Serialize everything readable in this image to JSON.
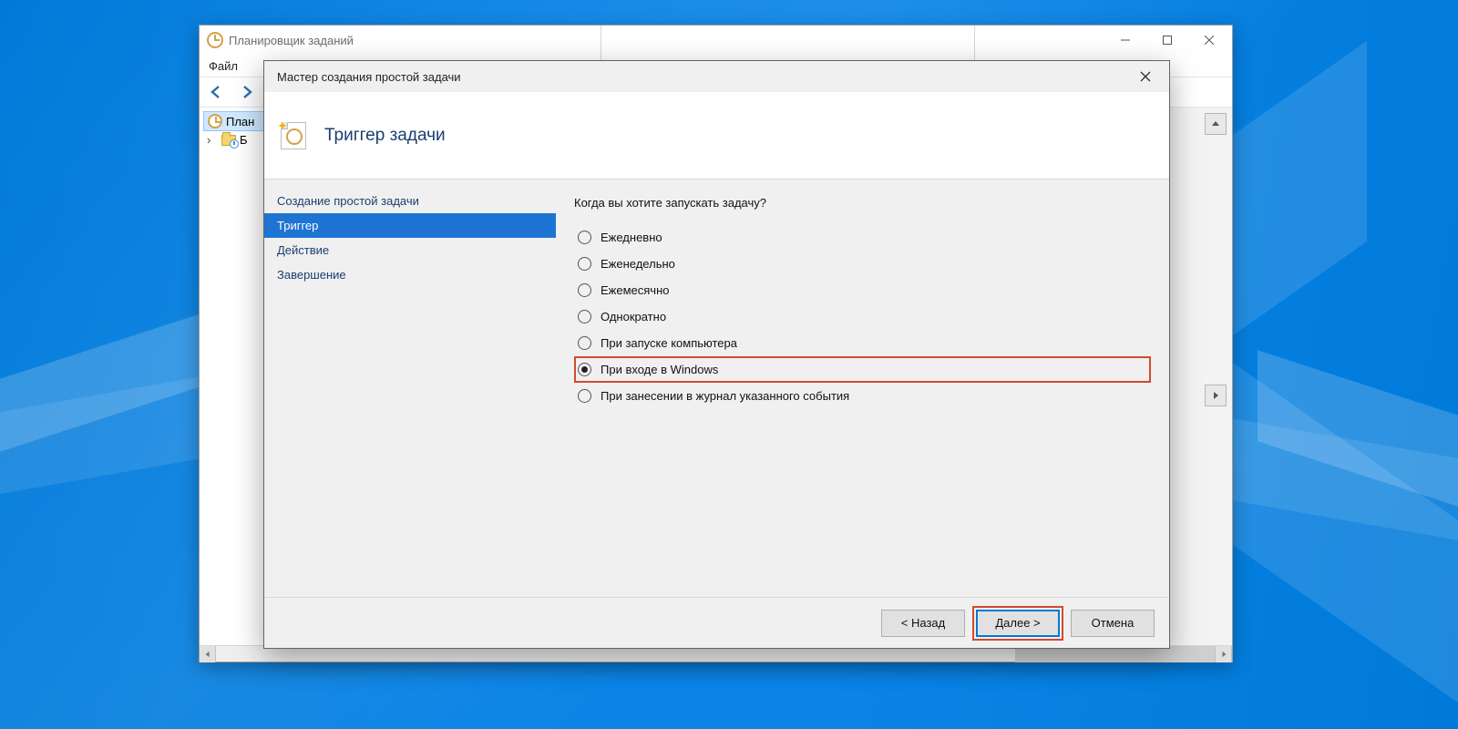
{
  "main_window": {
    "title": "Планировщик заданий",
    "menu": {
      "file": "Файл"
    },
    "tree": {
      "root": "Планировщик заданий",
      "library_short": "Библиотека планировщика заданий"
    }
  },
  "wizard": {
    "title": "Мастер создания простой задачи",
    "header": "Триггер задачи",
    "steps": {
      "create": "Создание простой задачи",
      "trigger": "Триггер",
      "action": "Действие",
      "finish": "Завершение"
    },
    "prompt": "Когда вы хотите запускать задачу?",
    "options": {
      "daily": "Ежедневно",
      "weekly": "Еженедельно",
      "monthly": "Ежемесячно",
      "once": "Однократно",
      "startup": "При запуске компьютера",
      "logon": "При входе в Windows",
      "event": "При занесении в журнал указанного события"
    },
    "buttons": {
      "back": "< Назад",
      "next": "Далее >",
      "cancel": "Отмена"
    }
  }
}
